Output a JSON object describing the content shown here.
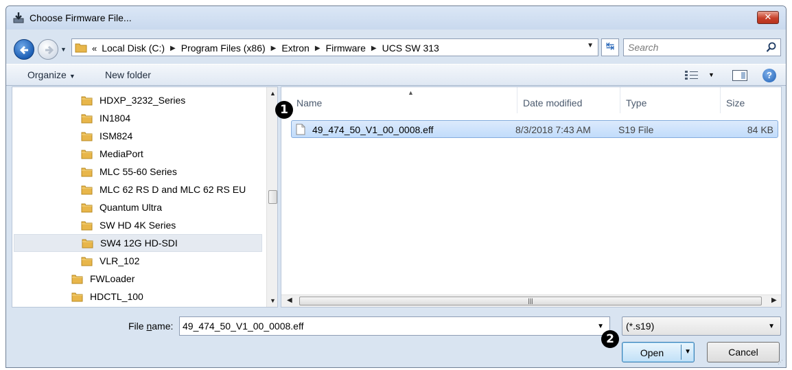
{
  "window": {
    "title": "Choose Firmware File..."
  },
  "address": {
    "crumbs": [
      "Local Disk (C:)",
      "Program Files (x86)",
      "Extron",
      "Firmware",
      "UCS SW 313"
    ],
    "overflow": "«"
  },
  "search": {
    "placeholder": "Search"
  },
  "toolbar": {
    "organize": "Organize",
    "new_folder": "New folder"
  },
  "nav": {
    "items": [
      {
        "label": "HDXP_3232_Series",
        "level": 2
      },
      {
        "label": "IN1804",
        "level": 2
      },
      {
        "label": "ISM824",
        "level": 2
      },
      {
        "label": "MediaPort",
        "level": 2
      },
      {
        "label": "MLC 55-60 Series",
        "level": 2
      },
      {
        "label": "MLC 62 RS D and MLC 62 RS EU",
        "level": 2
      },
      {
        "label": "Quantum Ultra",
        "level": 2
      },
      {
        "label": "SW HD 4K Series",
        "level": 2
      },
      {
        "label": "SW4 12G HD-SDI",
        "level": 2,
        "selected": true
      },
      {
        "label": "VLR_102",
        "level": 2
      },
      {
        "label": "FWLoader",
        "level": 1
      },
      {
        "label": "HDCTL_100",
        "level": 1
      }
    ]
  },
  "files": {
    "columns": [
      "Name",
      "Date modified",
      "Type",
      "Size"
    ],
    "rows": [
      {
        "name": "49_474_50_V1_00_0008.eff",
        "date": "8/3/2018 7:43 AM",
        "type": "S19 File",
        "size": "84 KB"
      }
    ]
  },
  "footer": {
    "file_name_label_pre": "File ",
    "file_name_label_u": "n",
    "file_name_label_post": "ame:",
    "file_name_value": "49_474_50_V1_00_0008.eff",
    "filter": "(*.s19)",
    "open": "Open",
    "cancel": "Cancel"
  },
  "callouts": {
    "one": "1",
    "two": "2"
  },
  "colors": {
    "selection": "#c1dcfb",
    "accent": "#1d5fb5",
    "folder": "#e8b64a"
  }
}
